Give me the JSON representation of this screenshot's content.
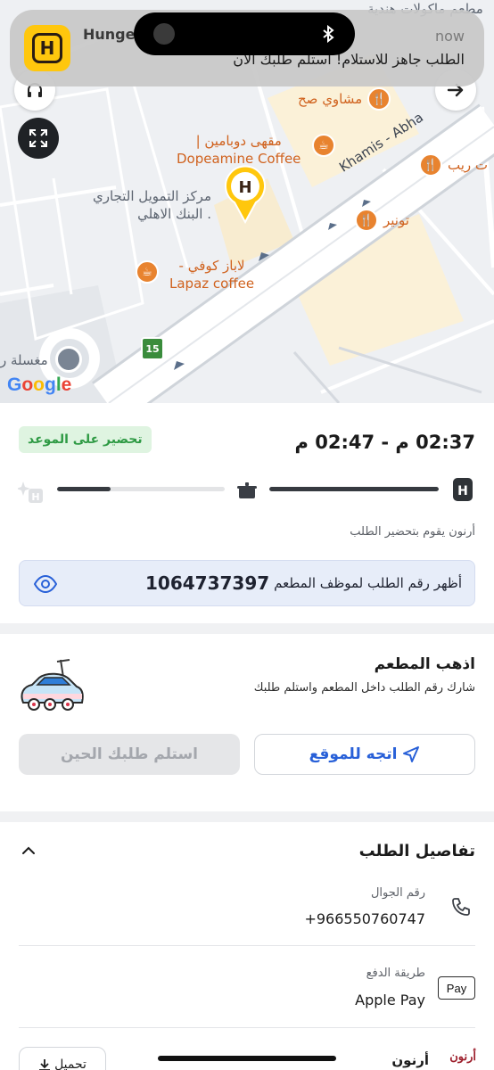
{
  "notification": {
    "app_name": "Hunge",
    "time": "now",
    "message": "الطلب جاهز للاستلام! استلم طلبك الآن",
    "icon": "hungerstation-logo",
    "app_icon_letter": "H"
  },
  "map": {
    "top_partial_label": "مطعم ماكولات هندية",
    "pois": {
      "mashawi_sah": "مشاوي صح",
      "dopeamine_ar": "مقهى دوبامين |",
      "dopeamine_en": "Dopeamine Coffee",
      "bank_1": "مركز التمويل التجاري",
      "bank_2": ". البنك الاهلي",
      "tunair": "تونير",
      "reib": "ت ريب",
      "lapaz_ar": "لاباز كوفي -",
      "lapaz_en": "Lapaz coffee",
      "laundry": "مغسلة ر"
    },
    "road_name": "Khamis - Abha",
    "road_shield": "15",
    "google_logo": "Google",
    "marker_letter": "H"
  },
  "order": {
    "status_badge": "تحضير على الموعد",
    "time_range": "02:37 م - 02:47 م",
    "progress": {
      "stage1_fraction": 1.0,
      "stage2_fraction": 0.32
    },
    "status_text": "أرنون  يقوم بتحضير الطلب",
    "order_number_label": "أظهر رقم الطلب لموظف المطعم",
    "order_number": "1064737397"
  },
  "go_to_restaurant": {
    "title": "اذهب المطعم",
    "subtitle": "شارك رقم الطلب داخل المطعم واستلم طلبك",
    "directions_button": "اتجه للموقع",
    "pickup_button": "استلم طلبك الحين"
  },
  "order_details": {
    "title": "تفاصيل الطلب",
    "phone_label": "رقم الجوال",
    "phone_value": "+966550760747",
    "payment_label": "طريقة الدفع",
    "payment_value": "Apple Pay",
    "applepay_badge": " Pay",
    "restaurant_name": "أرنون",
    "restaurant_logo": "أرنون",
    "download_button": "تحميل"
  },
  "colors": {
    "accent_blue": "#2860d8",
    "badge_green": "#2e9a44",
    "poi_orange": "#e8832f",
    "brand_yellow": "#ffc70d"
  }
}
